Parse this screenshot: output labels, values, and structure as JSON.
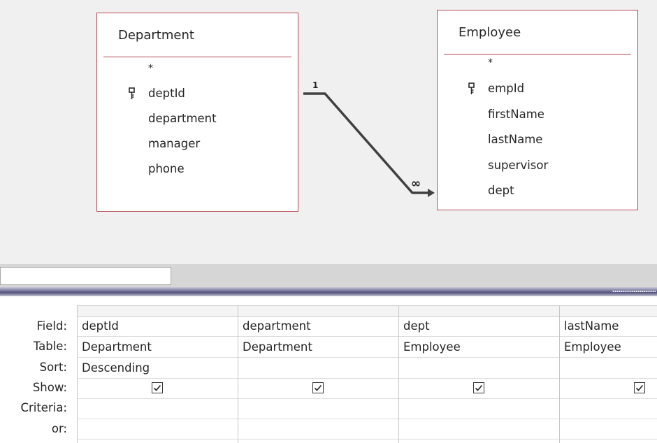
{
  "designer": {
    "tables": [
      {
        "name": "Department",
        "fields": [
          {
            "label": "*",
            "key": false
          },
          {
            "label": "deptId",
            "key": true
          },
          {
            "label": "department",
            "key": false
          },
          {
            "label": "manager",
            "key": false
          },
          {
            "label": "phone",
            "key": false
          }
        ]
      },
      {
        "name": "Employee",
        "fields": [
          {
            "label": "*",
            "key": false
          },
          {
            "label": "empId",
            "key": true
          },
          {
            "label": "firstName",
            "key": false
          },
          {
            "label": "lastName",
            "key": false
          },
          {
            "label": "supervisor",
            "key": false
          },
          {
            "label": "dept",
            "key": false
          }
        ]
      }
    ],
    "relationship": {
      "one_label": "1",
      "many_label": "∞"
    }
  },
  "grid": {
    "row_labels": {
      "field": "Field:",
      "table": "Table:",
      "sort": "Sort:",
      "show": "Show:",
      "criteria": "Criteria:",
      "or": "or:"
    },
    "columns": [
      {
        "field": "deptId",
        "table": "Department",
        "sort": "Descending",
        "show": true,
        "criteria": "",
        "or": ""
      },
      {
        "field": "department",
        "table": "Department",
        "sort": "",
        "show": true,
        "criteria": "",
        "or": ""
      },
      {
        "field": "dept",
        "table": "Employee",
        "sort": "",
        "show": true,
        "criteria": "",
        "or": ""
      },
      {
        "field": "lastName",
        "table": "Employee",
        "sort": "",
        "show": true,
        "criteria": "",
        "or": ""
      }
    ]
  },
  "colors": {
    "table_border": "#b84a55",
    "designer_background": "#f0f0f0",
    "splitter": "#54547e"
  }
}
